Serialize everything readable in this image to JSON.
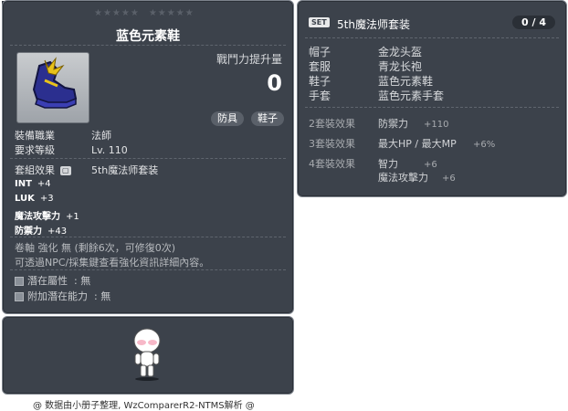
{
  "item_id": "01072268",
  "item": {
    "title": "蓝色元素鞋",
    "power_label": "戰鬥力提升量",
    "power_value": "0",
    "tags": [
      "防具",
      "鞋子"
    ],
    "job_label": "裝備職業",
    "job_value": "法師",
    "level_label": "要求等級",
    "level_value": "Lv. 110",
    "set_label": "套組效果",
    "set_value": "5th魔法师套装",
    "stats": [
      {
        "name": "INT",
        "value": "+4"
      },
      {
        "name": "LUK",
        "value": "+3"
      },
      {
        "name": "魔法攻擊力",
        "value": "+1"
      },
      {
        "name": "防禦力",
        "value": "+43"
      }
    ],
    "scroll_note": "卷軸 強化 無 (剩餘6次，可修復0次)",
    "info_note": "可透過NPC/採集鍵查看強化資訊詳細內容。",
    "potential_label": "潛在屬性",
    "potential_value": ": 無",
    "bonus_potential_label": "附加潛在能力",
    "bonus_potential_value": ": 無"
  },
  "set": {
    "badge": "SET",
    "name": "5th魔法师套装",
    "count": "0 / 4",
    "pieces": [
      {
        "slot": "帽子",
        "name": "金龙头盔"
      },
      {
        "slot": "套服",
        "name": "青龙长袍"
      },
      {
        "slot": "鞋子",
        "name": "蓝色元素鞋"
      },
      {
        "slot": "手套",
        "name": "蓝色元素手套"
      }
    ],
    "effects": [
      {
        "label": "2套裝效果",
        "lines": [
          {
            "name": "防禦力",
            "value": "+110"
          }
        ]
      },
      {
        "label": "3套裝效果",
        "lines": [
          {
            "name": "最大HP / 最大MP",
            "value": "+6%"
          }
        ]
      },
      {
        "label": "4套裝效果",
        "lines": [
          {
            "name": "智力",
            "value": "+6"
          },
          {
            "name": "魔法攻擊力",
            "value": "+6"
          }
        ]
      }
    ]
  },
  "footer": "@ 数据由小册子整理, WzComparerR2-NTMS解析 @",
  "colors": {
    "panel": "#3c424b",
    "border": "#7d838c",
    "text": "#e8e8e8"
  }
}
